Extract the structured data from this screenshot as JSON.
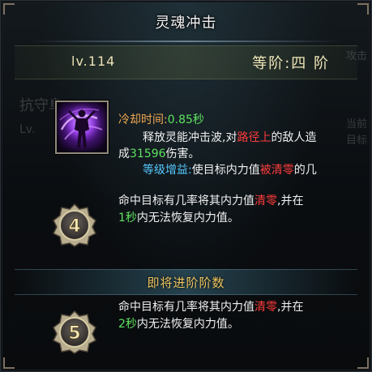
{
  "tooltip": {
    "title": "灵魂冲击",
    "level": "lv.114",
    "rank": "等阶:四 阶",
    "skill": {
      "icon": "purple-spirit-shockwave-icon",
      "cooldown_label": "冷却时间:",
      "cooldown_value": "0.85秒",
      "desc_part1": "释放灵能冲击波,对",
      "desc_red": "路径上",
      "desc_part2": "的敌人造",
      "desc_part3": "成",
      "damage": "31596",
      "desc_part4": "伤害。",
      "grade_label": "等级增益:",
      "grade_part1": "使目标内力值",
      "grade_red": "被清零",
      "grade_part2": "的几"
    },
    "rank4": {
      "number": "4",
      "l1_part1": "命中目标有几率将其内力值",
      "l1_red": "清零",
      "l1_part2": ",并在",
      "l2_secs": "1秒",
      "l2_part": "内无法恢复内力值。"
    },
    "advance_title": "即将进阶阶数",
    "rank5": {
      "number": "5",
      "l1_part1": "命中目标有几率将其内力值",
      "l1_red": "清零",
      "l1_part2": ",并在",
      "l2_secs": "2秒",
      "l2_part": "内无法恢复内力值。"
    }
  },
  "background_window": {
    "right_1": "攻击",
    "right_2": "当前",
    "right_3": "目标",
    "left_1": "抗守阜",
    "left_2": "Lv."
  },
  "colors": {
    "green": "#5fe35f",
    "red": "#ff3b3b",
    "cyan": "#55c8ff",
    "gold": "#eec55f"
  }
}
